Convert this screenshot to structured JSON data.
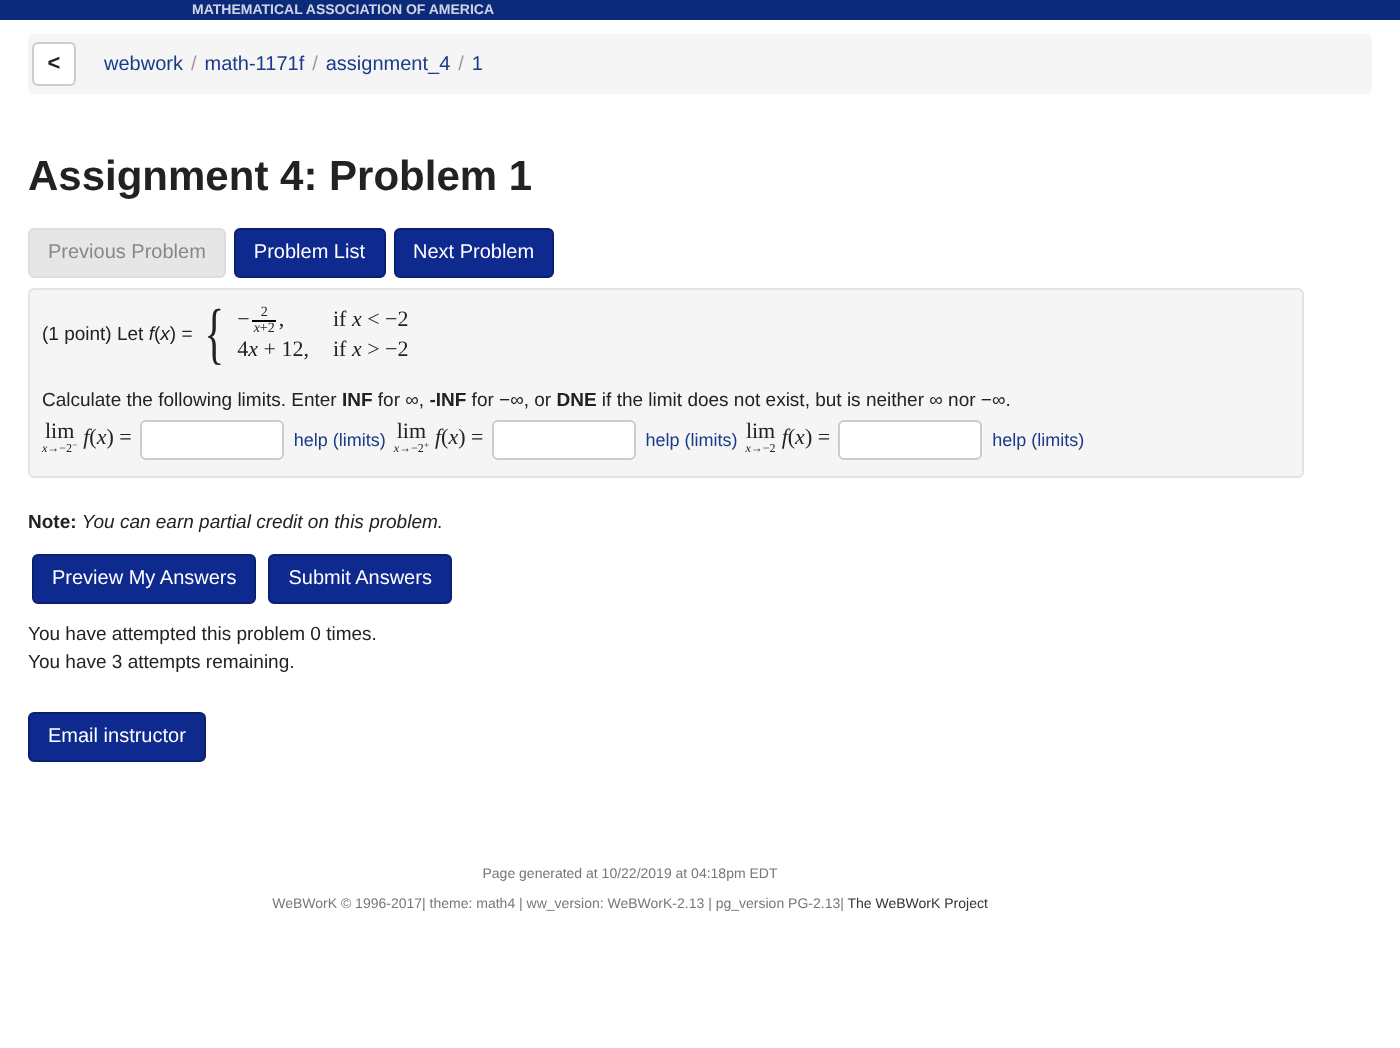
{
  "banner": {
    "text": "MATHEMATICAL ASSOCIATION OF AMERICA"
  },
  "breadcrumb": {
    "back": "<",
    "separator": "/",
    "items": [
      "webwork",
      "math-1171f",
      "assignment_4",
      "1"
    ]
  },
  "title": "Assignment 4: Problem 1",
  "nav_buttons": [
    {
      "label": "Previous Problem",
      "disabled": true
    },
    {
      "label": "Problem List",
      "disabled": false
    },
    {
      "label": "Next Problem",
      "disabled": false
    }
  ],
  "problem": {
    "intro": "(1 point) Let *f*(*x*) =",
    "brace": "{",
    "pieces": [
      {
        "kind": "fraction",
        "sign": "−",
        "numerator": "2",
        "denominator": "*x*+2",
        "suffix": ",",
        "condition": "if *x* < −2"
      },
      {
        "kind": "text",
        "coefficient": "4",
        "variable": "x",
        "rest": " + 12,",
        "condition": "if *x* > −2"
      }
    ],
    "instructions": "Calculate the following limits. Enter **INF** for ∞, **-INF** for −∞, or **DNE** if the limit does not exist, but is neither ∞ nor −∞.",
    "limits": [
      {
        "lim": "lim",
        "sub": "*x*→−2$^{−}$",
        "expr": "*f*(*x*) =",
        "help": "help (limits)"
      },
      {
        "lim": "lim",
        "sub": "*x*→−2$^{+}$",
        "expr": "*f*(*x*) =",
        "help": "help (limits)"
      },
      {
        "lim": "lim",
        "sub": "*x*→−2",
        "expr": "*f*(*x*) =",
        "help": "help (limits)"
      }
    ]
  },
  "note": "**Note:** *You can earn partial credit on this problem.*",
  "answer_buttons": [
    "Preview My Answers",
    "Submit Answers"
  ],
  "attempts": [
    "You have attempted this problem 0 times.",
    "You have 3 attempts remaining."
  ],
  "email_button": "Email instructor",
  "footer": {
    "generated": "Page generated at 10/22/2019 at 04:18pm EDT",
    "credits": "WeBWorK © 1996-2017| theme: math4 | ww_version: WeBWorK-2.13 | pg_version PG-2.13|",
    "project": "The WeBWorK Project"
  }
}
